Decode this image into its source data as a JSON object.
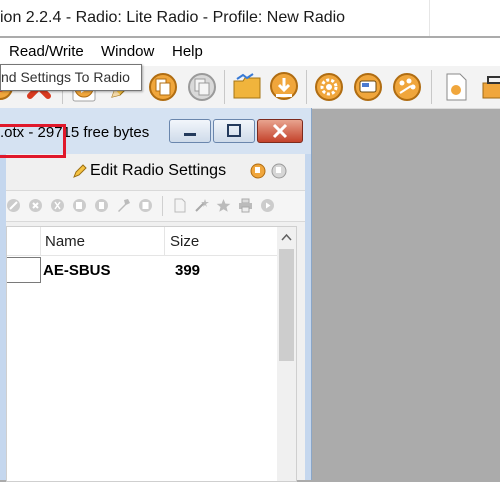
{
  "app": {
    "title": "ion 2.2.4 - Radio: Lite Radio - Profile: New Radio"
  },
  "menu": [
    "Read/Write",
    "Window",
    "Help"
  ],
  "toolbar_icons": [
    "radio-icon",
    "delete-icon",
    "play-icon",
    "pencil-icon",
    "copy-icon",
    "paste-icon",
    "open-folder-icon",
    "download-icon",
    "settings-gear-icon",
    "radio-settings-icon",
    "palette-icon",
    "document-icon",
    "toolbox-icon"
  ],
  "model_window": {
    "title": ".otx - 29715 free bytes",
    "tab_edit": "Edit Radio Settings",
    "tooltip": "nd Settings To Radio"
  },
  "list": {
    "columns": [
      "Name",
      "Size"
    ],
    "rows": [
      {
        "name": "AE-SBUS",
        "size": "399"
      }
    ]
  },
  "colors": {
    "annotation": "#e0182b",
    "close_button": "#c4422b"
  }
}
